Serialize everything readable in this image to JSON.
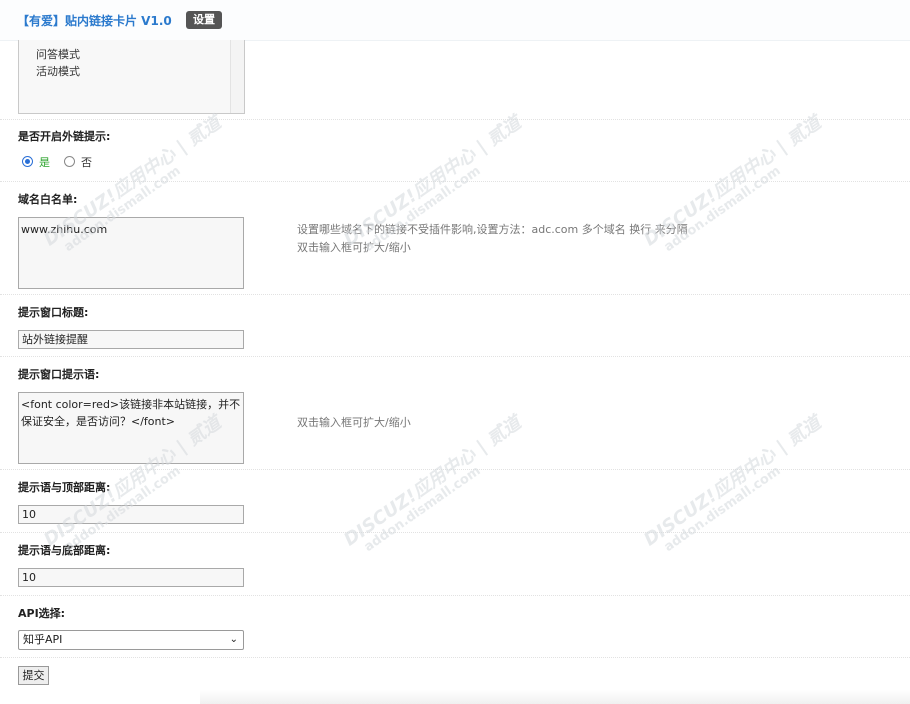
{
  "header": {
    "title": "【有爱】贴内链接卡片 V1.0",
    "settings_tag": "设置"
  },
  "mode_list": {
    "items": [
      "问答模式",
      "活动模式"
    ]
  },
  "external_prompt": {
    "label": "是否开启外链提示:",
    "options": [
      {
        "label": "是",
        "selected": true,
        "color": "#2aa32a"
      },
      {
        "label": "否",
        "selected": false
      }
    ]
  },
  "whitelist": {
    "label": "域名白名单:",
    "value": "www.zhihu.com",
    "hint": "设置哪些域名下的链接不受插件影响,设置方法：adc.com 多个域名 换行 来分隔",
    "hint2": "双击输入框可扩大/缩小"
  },
  "window_title": {
    "label": "提示窗口标题:",
    "value": "站外链接提醒"
  },
  "window_message": {
    "label": "提示窗口提示语:",
    "value": "<font color=red>该链接非本站链接，并不保证安全，是否访问？</font>",
    "hint": "双击输入框可扩大/缩小"
  },
  "top_distance": {
    "label": "提示语与顶部距离:",
    "value": "10"
  },
  "bottom_distance": {
    "label": "提示语与底部距离:",
    "value": "10"
  },
  "api": {
    "label": "API选择:",
    "selected": "知乎API"
  },
  "submit": {
    "label": "提交"
  },
  "watermark": {
    "line1": "DISCUZ!应用中心 | 贰道",
    "line2": "addon.dismall.com"
  },
  "colors": {
    "title_blue": "#2b7acd",
    "tag_gray": "#555555"
  }
}
